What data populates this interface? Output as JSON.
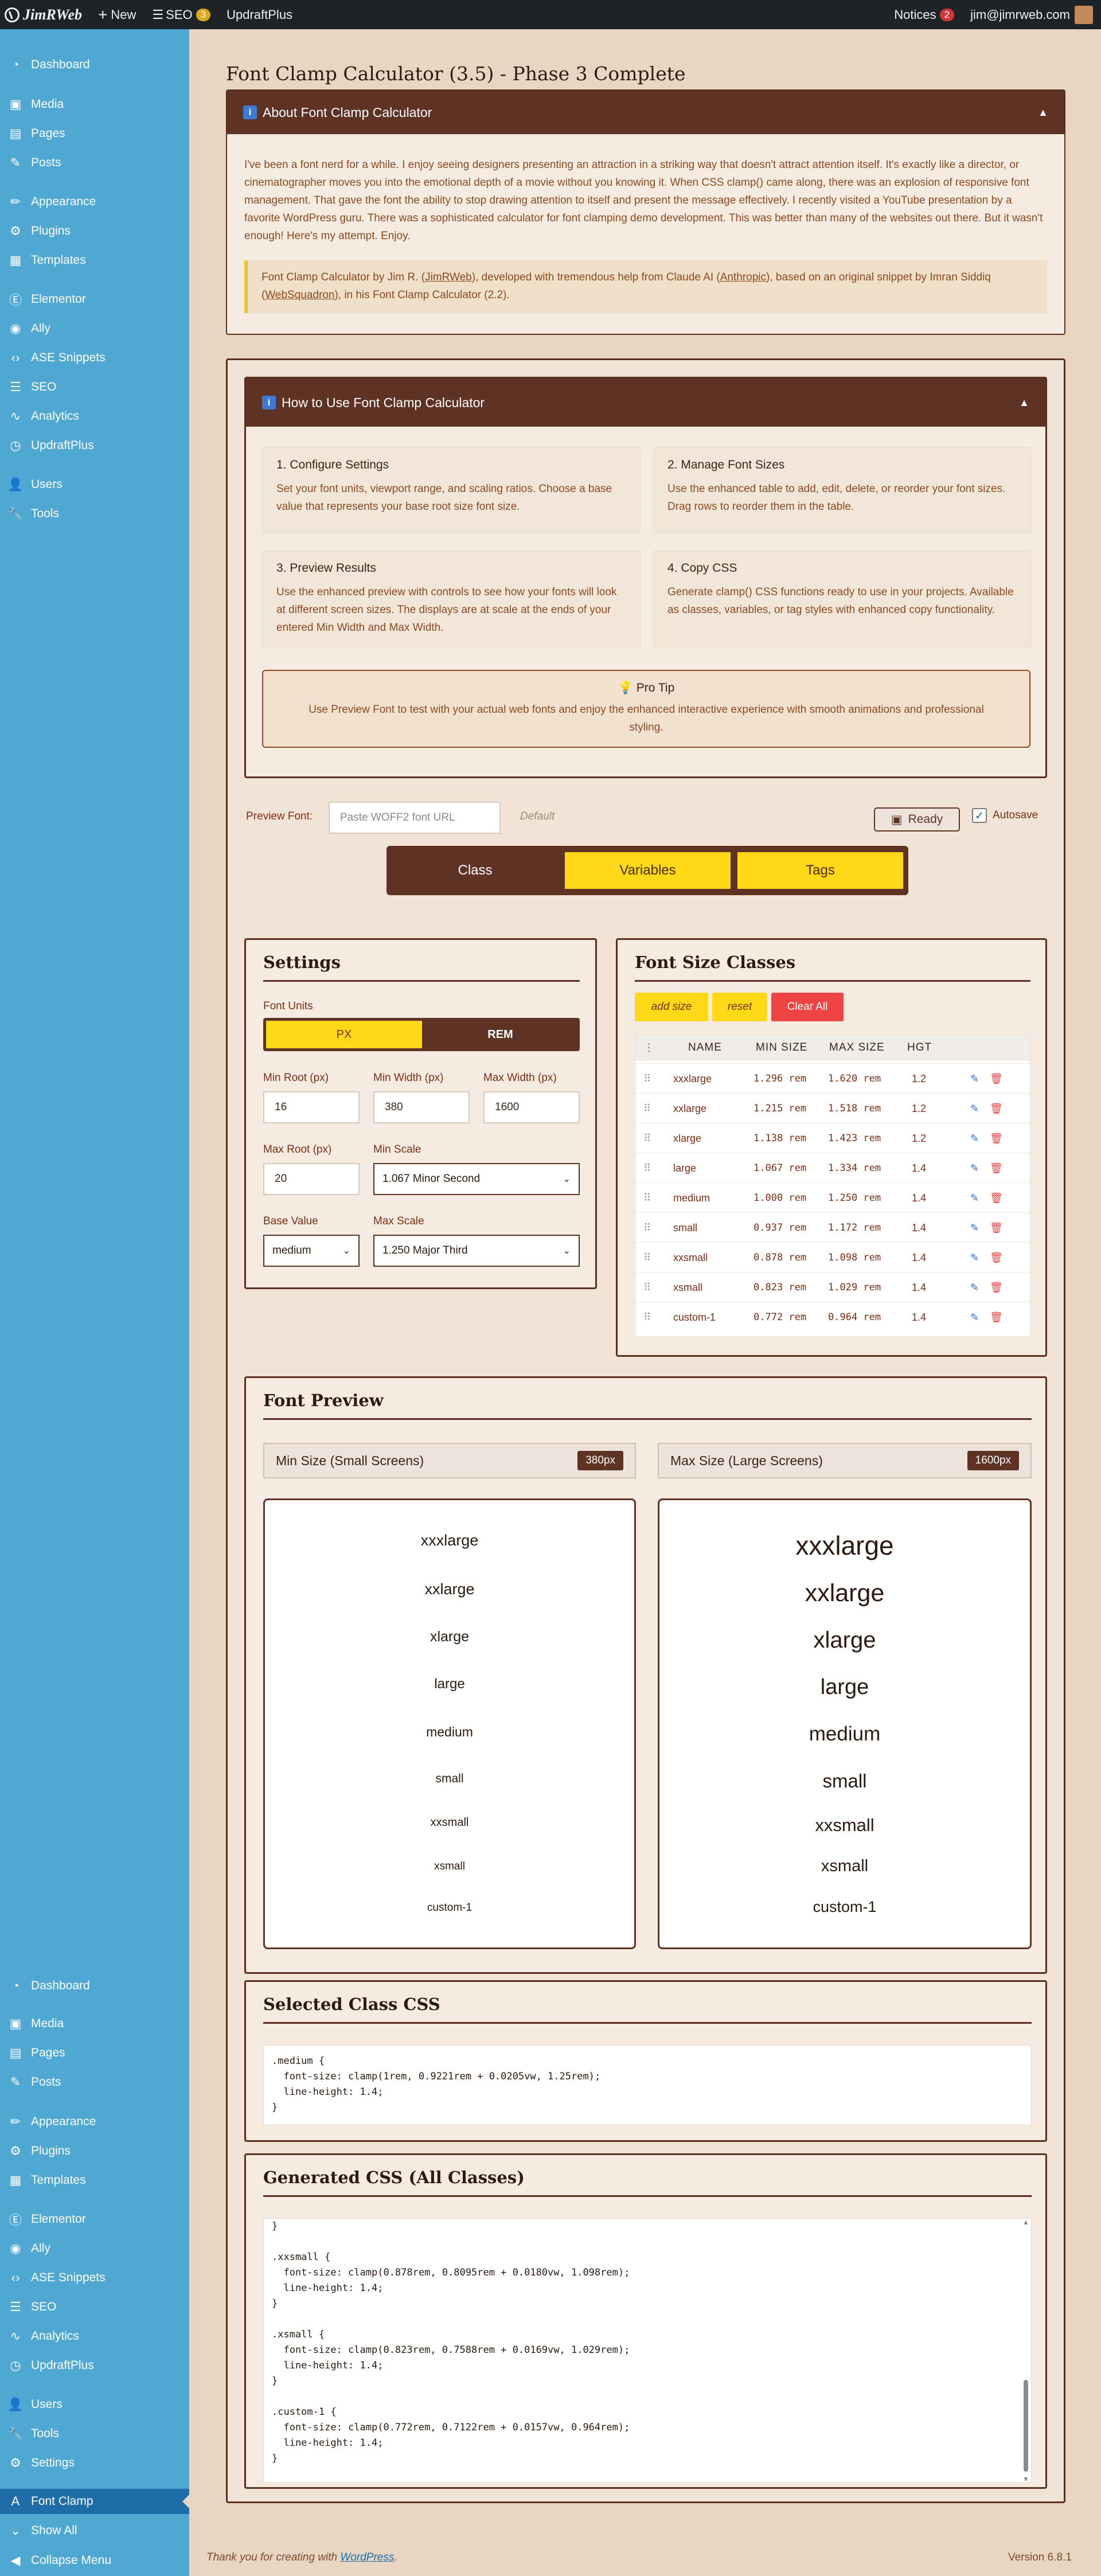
{
  "adminbar": {
    "site": "JimRWeb",
    "new": "New",
    "seo": "SEO",
    "seo_count": "3",
    "updraft": "UpdraftPlus",
    "notices": "Notices",
    "notices_count": "2",
    "user": "jim@jimrweb.com"
  },
  "sidebar": {
    "items": [
      "Dashboard",
      "Media",
      "Pages",
      "Posts",
      "Appearance",
      "Plugins",
      "Templates",
      "Elementor",
      "Ally",
      "ASE Snippets",
      "SEO",
      "Analytics",
      "UpdraftPlus",
      "Users",
      "Tools",
      "Settings",
      "Font Clamp",
      "Show All",
      "Collapse Menu"
    ]
  },
  "page": {
    "title": "Font Clamp Calculator (3.5) - Phase 3 Complete"
  },
  "about": {
    "header": "About Font Clamp Calculator",
    "text": "I've been a font nerd for a while. I enjoy seeing designers presenting an attraction in a striking way that doesn't attract attention itself. It's exactly like a director, or cinematographer moves you into the emotional depth of a movie without you knowing it. When CSS clamp() came along, there was an explosion of responsive font management. That gave the font the ability to stop drawing attention to itself and present the message effectively. I recently visited a YouTube presentation by a favorite WordPress guru. There was a sophisticated calculator for font clamping demo development. This was better than many of the websites out there. But it wasn't enough! Here's my attempt. Enjoy.",
    "credit_1": "Font Clamp Calculator by Jim R. (",
    "credit_link1": "JimRWeb",
    "credit_2": "), developed with tremendous help from Claude AI (",
    "credit_link2": "Anthropic",
    "credit_3": "), based on an original snippet by Imran Siddiq (",
    "credit_link3": "WebSquadron",
    "credit_4": "), in his Font Clamp Calculator (2.2)."
  },
  "howto": {
    "header": "How to Use Font Clamp Calculator",
    "steps": [
      {
        "title": "1. Configure Settings",
        "desc": "Set your font units, viewport range, and scaling ratios. Choose a base value that represents your base root size font size."
      },
      {
        "title": "2. Manage Font Sizes",
        "desc": "Use the enhanced table to add, edit, delete, or reorder your font sizes. Drag rows to reorder them in the table."
      },
      {
        "title": "3. Preview Results",
        "desc": "Use the enhanced preview with controls to see how your fonts will look at different screen sizes. The displays are at scale at the ends of your entered Min Width and Max Width."
      },
      {
        "title": "4. Copy CSS",
        "desc": "Generate clamp() CSS functions ready to use in your projects. Available as classes, variables, or tag styles with enhanced copy functionality."
      }
    ],
    "tip_title": "Pro Tip",
    "tip_text": "Use Preview Font to test with your actual web fonts and enjoy the enhanced interactive experience with smooth animations and professional styling."
  },
  "toolbar": {
    "preview_font_label": "Preview Font:",
    "font_url_placeholder": "Paste WOFF2 font URL",
    "default_label": "Default",
    "ready_label": "Ready",
    "autosave_label": "Autosave"
  },
  "tabs": [
    "Class",
    "Variables",
    "Tags"
  ],
  "settings": {
    "title": "Settings",
    "font_units_label": "Font Units",
    "unit_px": "PX",
    "unit_rem": "REM",
    "min_root_label": "Min Root (px)",
    "min_root": "16",
    "min_width_label": "Min Width (px)",
    "min_width": "380",
    "max_width_label": "Max Width (px)",
    "max_width": "1600",
    "max_root_label": "Max Root (px)",
    "max_root": "20",
    "min_scale_label": "Min Scale",
    "min_scale": "1.067 Minor Second",
    "base_value_label": "Base Value",
    "base_value": "medium",
    "max_scale_label": "Max Scale",
    "max_scale": "1.250 Major Third"
  },
  "classes": {
    "title": "Font Size Classes",
    "add_label": "add size",
    "reset_label": "reset",
    "clear_label": "Clear All",
    "headers": {
      "name": "NAME",
      "min": "MIN SIZE",
      "max": "MAX SIZE",
      "hgt": "HGT"
    },
    "rows": [
      {
        "name": "xxxlarge",
        "min": "1.296 rem",
        "max": "1.620 rem",
        "hgt": "1.2"
      },
      {
        "name": "xxlarge",
        "min": "1.215 rem",
        "max": "1.518 rem",
        "hgt": "1.2"
      },
      {
        "name": "xlarge",
        "min": "1.138 rem",
        "max": "1.423 rem",
        "hgt": "1.2"
      },
      {
        "name": "large",
        "min": "1.067 rem",
        "max": "1.334 rem",
        "hgt": "1.4"
      },
      {
        "name": "medium",
        "min": "1.000 rem",
        "max": "1.250 rem",
        "hgt": "1.4"
      },
      {
        "name": "small",
        "min": "0.937 rem",
        "max": "1.172 rem",
        "hgt": "1.4"
      },
      {
        "name": "xxsmall",
        "min": "0.878 rem",
        "max": "1.098 rem",
        "hgt": "1.4"
      },
      {
        "name": "xsmall",
        "min": "0.823 rem",
        "max": "1.029 rem",
        "hgt": "1.4"
      },
      {
        "name": "custom-1",
        "min": "0.772 rem",
        "max": "0.964 rem",
        "hgt": "1.4"
      }
    ]
  },
  "preview": {
    "title": "Font Preview",
    "min_label": "Min Size (Small Screens)",
    "min_badge": "380px",
    "max_label": "Max Size (Large Screens)",
    "max_badge": "1600px"
  },
  "selected_css": {
    "title": "Selected Class CSS",
    "code": ".medium {\n  font-size: clamp(1rem, 0.9221rem + 0.0205vw, 1.25rem);\n  line-height: 1.4;\n}"
  },
  "generated_css": {
    "title": "Generated CSS (All Classes)",
    "code": "}\n\n.xxsmall {\n  font-size: clamp(0.878rem, 0.8095rem + 0.0180vw, 1.098rem);\n  line-height: 1.4;\n}\n\n.xsmall {\n  font-size: clamp(0.823rem, 0.7588rem + 0.0169vw, 1.029rem);\n  line-height: 1.4;\n}\n\n.custom-1 {\n  font-size: clamp(0.772rem, 0.7122rem + 0.0157vw, 0.964rem);\n  line-height: 1.4;\n}"
  },
  "footer": {
    "thanks": "Thank you for creating with ",
    "wp": "WordPress",
    "version": "Version 6.8.1"
  }
}
